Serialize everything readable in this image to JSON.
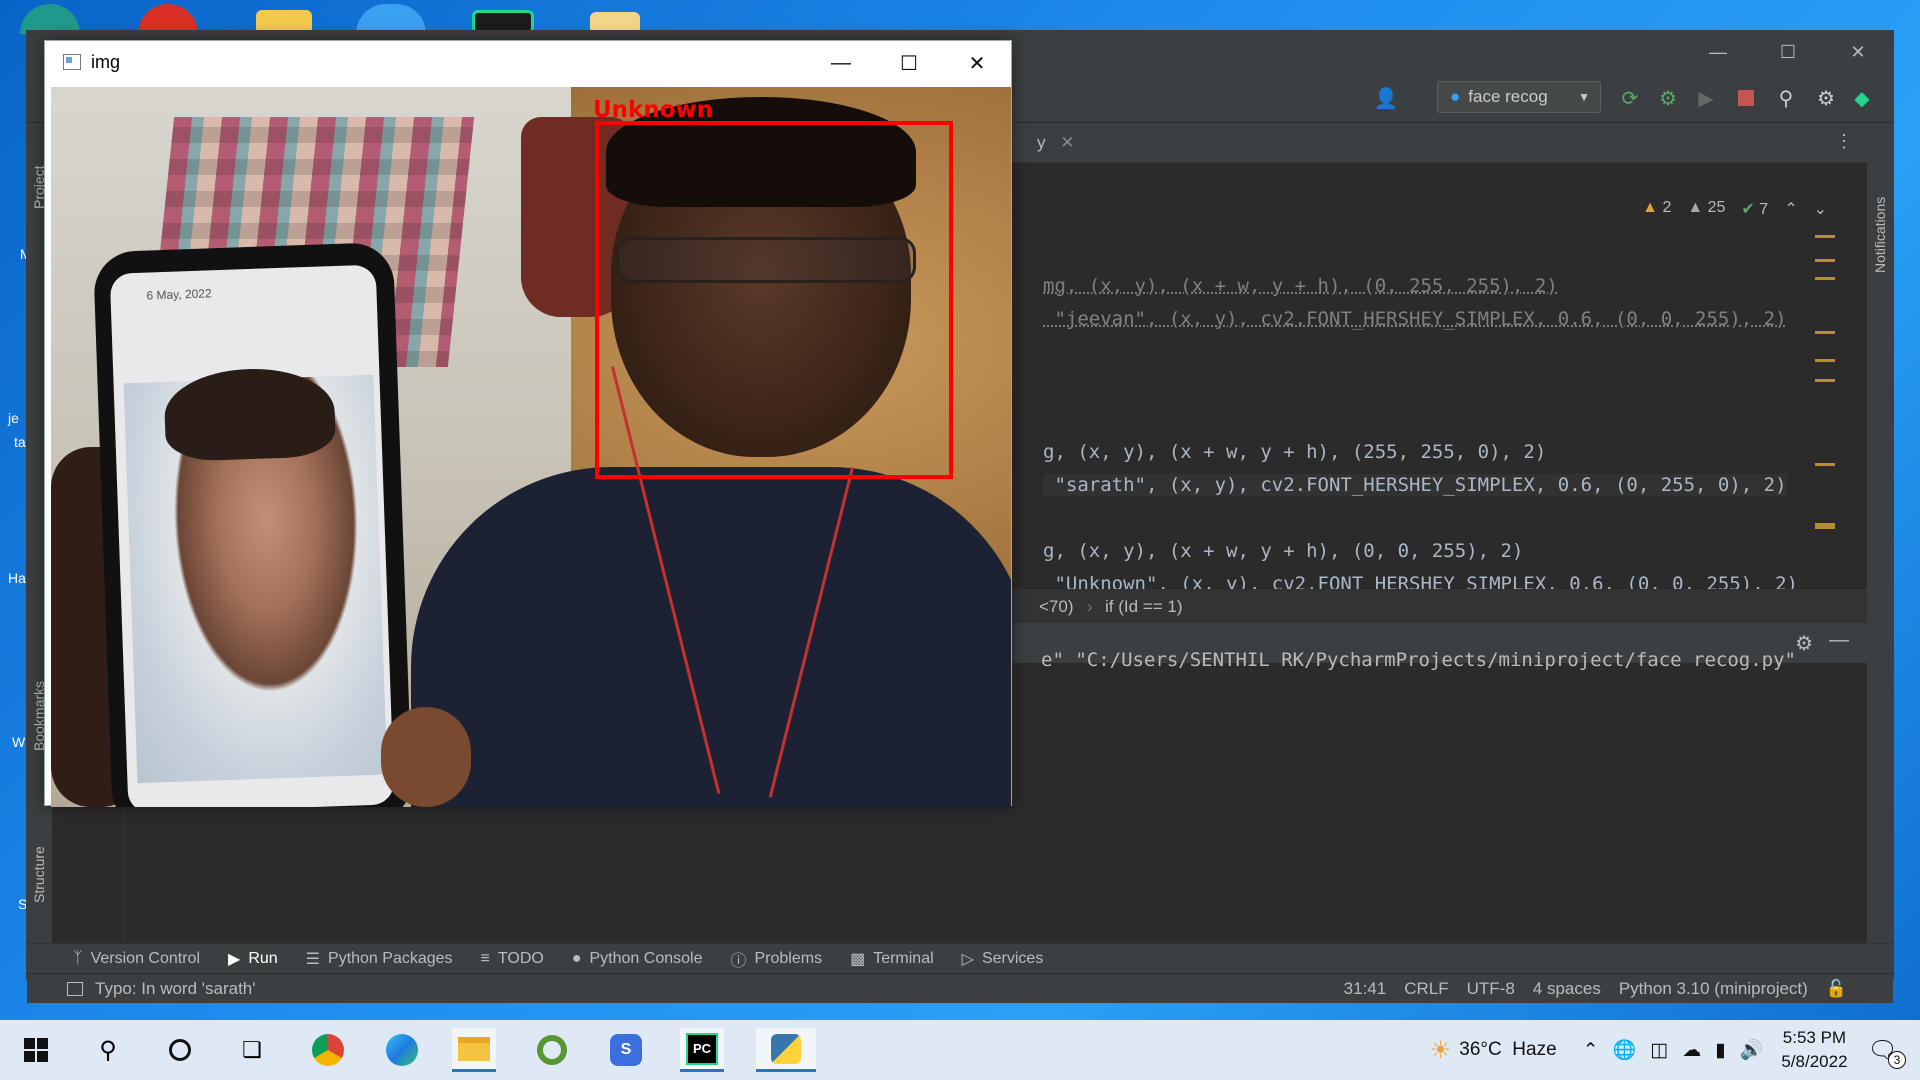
{
  "ide": {
    "run_config": "face recog",
    "inspections": {
      "warnings_a": "2",
      "warnings_b": "25",
      "ok": "7"
    },
    "left_tools": [
      "Project",
      "Bookmarks",
      "Structure"
    ],
    "right_tools": [
      "Notifications"
    ],
    "editor_tab_fragment": "y",
    "code_lines": [
      "mg, (x, y), (x + w, y + h), (0, 255, 255), 2)",
      " \"jeevan\", (x, y), cv2.FONT_HERSHEY_SIMPLEX, 0.6, (0, 0, 255), 2)",
      "g, (x, y), (x + w, y + h), (255, 255, 0), 2)",
      " \"sarath\", (x, y), cv2.FONT_HERSHEY_SIMPLEX, 0.6, (0, 255, 0), 2)",
      "g, (x, y), (x + w, y + h), (0, 0, 255), 2)",
      " \"Unknown\", (x, y), cv2.FONT_HERSHEY_SIMPLEX, 0.6, (0, 0, 255), 2)"
    ],
    "breadcrumb": {
      "part1": "<70)",
      "part2": "if (Id == 1)"
    },
    "console_line": "e\" \"C:/Users/SENTHIL RK/PycharmProjects/miniproject/face recog.py\"",
    "bottom_tabs": [
      "Version Control",
      "Run",
      "Python Packages",
      "TODO",
      "Python Console",
      "Problems",
      "Terminal",
      "Services"
    ],
    "status": {
      "message": "Typo: In word 'sarath'",
      "position": "31:41",
      "line_sep": "CRLF",
      "encoding": "UTF-8",
      "indent": "4 spaces",
      "interpreter": "Python 3.10 (miniproject)"
    }
  },
  "img_window": {
    "title": "img",
    "face_label": "Unknown",
    "phone_date": "6 May, 2022",
    "box_color": "#ff0000"
  },
  "desktop_labels": [
    "M",
    "je",
    "ta",
    "Ha",
    "W",
    "S"
  ],
  "taskbar": {
    "weather": "36°C  Haze",
    "time": "5:53 PM",
    "date": "5/8/2022",
    "notification_count": "3",
    "apps": [
      "start-icon",
      "search-icon",
      "cortana-icon",
      "task-view-icon",
      "chrome-icon",
      "edge-icon",
      "file-explorer-icon",
      "qgis-icon",
      "s-app-icon",
      "pycharm-icon",
      "python-icon"
    ]
  }
}
